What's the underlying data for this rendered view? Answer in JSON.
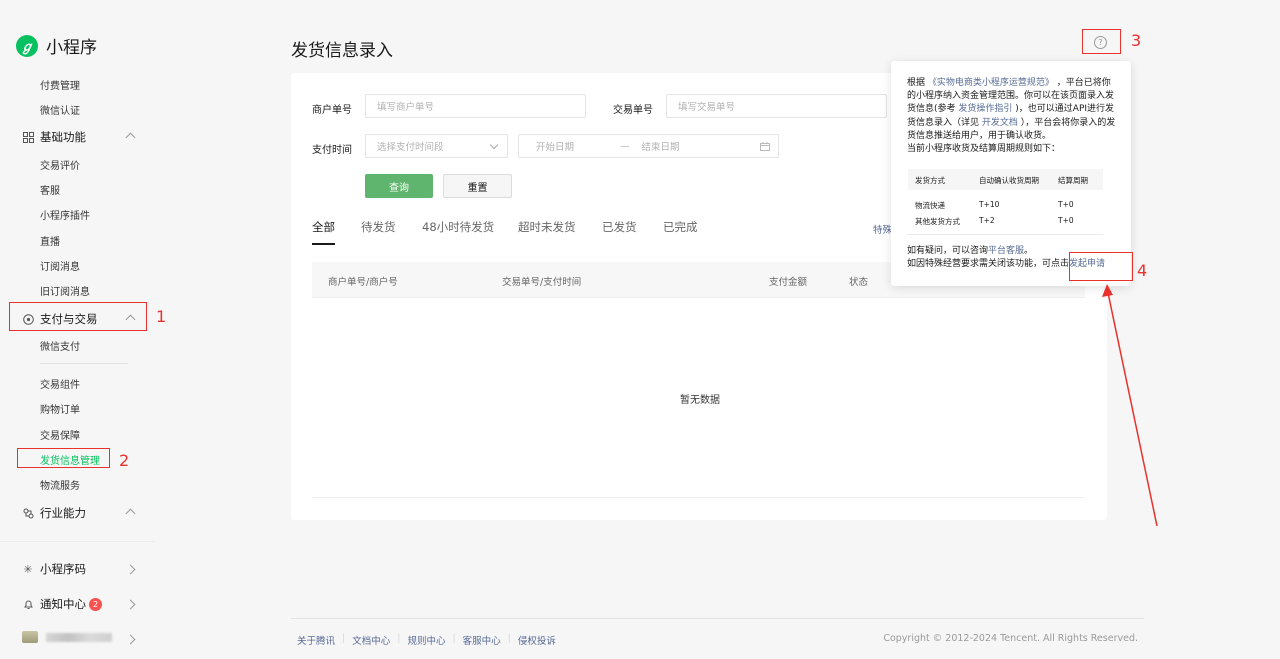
{
  "app": {
    "name": "小程序"
  },
  "sidebar": {
    "pre_items": [
      "付费管理",
      "微信认证"
    ],
    "group_basic": {
      "label": "基础功能",
      "items": [
        "交易评价",
        "客服",
        "小程序插件",
        "直播",
        "订阅消息",
        "旧订阅消息"
      ]
    },
    "group_pay": {
      "label": "支付与交易",
      "items_a": [
        "微信支付"
      ],
      "items_b": [
        "交易组件",
        "购物订单",
        "交易保障",
        "发货信息管理",
        "物流服务"
      ]
    },
    "group_industry": {
      "label": "行业能力"
    },
    "bottom": {
      "qrcode": "小程序码",
      "notice": "通知中心",
      "notice_count": "2"
    }
  },
  "page": {
    "title": "发货信息录入"
  },
  "filters": {
    "merchant_label": "商户单号",
    "merchant_placeholder": "填写商户单号",
    "trade_label": "交易单号",
    "trade_placeholder": "填写交易单号",
    "paytime_label": "支付时间",
    "paytime_select": "选择支付时间段",
    "date_start": "开始日期",
    "date_sep": "—",
    "date_end": "结束日期",
    "query_btn": "查询",
    "reset_btn": "重置"
  },
  "tabs": [
    "全部",
    "待发货",
    "48小时待发货",
    "超时未发货",
    "已发货",
    "已完成"
  ],
  "special_link": "特殊",
  "table": {
    "headers": [
      "商户单号/商户号",
      "交易单号/支付时间",
      "支付金额",
      "状态"
    ],
    "empty_text": "暂无数据"
  },
  "popover": {
    "para": [
      "根据",
      "《实物电商类小程序运营规范》",
      "，平台已将你的小程序纳入资金管理范围。你可以在该页面录入发货信息(参考",
      "发货操作指引",
      ")，也可以通过API进行发货信息录入（详见",
      "开发文档",
      "），平台会将你录入的发货信息推送给用户，用于确认收货。"
    ],
    "rule_line": "当前小程序收货及结算周期规则如下：",
    "rules_headers": [
      "发货方式",
      "自动确认收货周期",
      "结算周期"
    ],
    "rules_rows": [
      [
        "物流快递",
        "T+10",
        "T+0"
      ],
      [
        "其他发货方式",
        "T+2",
        "T+0"
      ]
    ],
    "foot1_a": "如有疑问，可以咨询",
    "foot1_link": "平台客服",
    "foot1_b": "。",
    "foot2_a": "如因特殊经营要求需关闭该功能，可点击",
    "foot2_link": "发起申请"
  },
  "annotations": [
    "1",
    "2",
    "3",
    "4"
  ],
  "footer": {
    "links": [
      "关于腾讯",
      "文档中心",
      "规则中心",
      "客服中心",
      "侵权投诉"
    ],
    "copyright": "Copyright © 2012-2024 Tencent. All Rights Reserved."
  },
  "colors": {
    "brand": "#07c160",
    "annotation": "#e8322d",
    "link": "#576b95"
  }
}
